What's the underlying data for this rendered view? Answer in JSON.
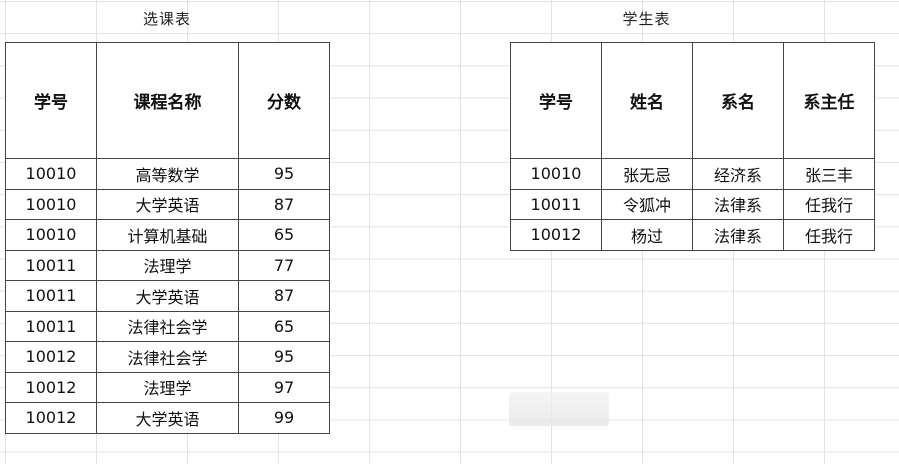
{
  "sheet": {
    "course_table": {
      "title": "选课表",
      "headers": [
        "学号",
        "课程名称",
        "分数"
      ],
      "rows": [
        [
          "10010",
          "高等数学",
          "95"
        ],
        [
          "10010",
          "大学英语",
          "87"
        ],
        [
          "10010",
          "计算机基础",
          "65"
        ],
        [
          "10011",
          "法理学",
          "77"
        ],
        [
          "10011",
          "大学英语",
          "87"
        ],
        [
          "10011",
          "法律社会学",
          "65"
        ],
        [
          "10012",
          "法律社会学",
          "95"
        ],
        [
          "10012",
          "法理学",
          "97"
        ],
        [
          "10012",
          "大学英语",
          "99"
        ]
      ]
    },
    "student_table": {
      "title": "学生表",
      "headers": [
        "学号",
        "姓名",
        "系名",
        "系主任"
      ],
      "rows": [
        [
          "10010",
          "张无忌",
          "经济系",
          "张三丰"
        ],
        [
          "10011",
          "令狐冲",
          "法律系",
          "任我行"
        ],
        [
          "10012",
          "杨过",
          "法律系",
          "任我行"
        ]
      ]
    }
  }
}
